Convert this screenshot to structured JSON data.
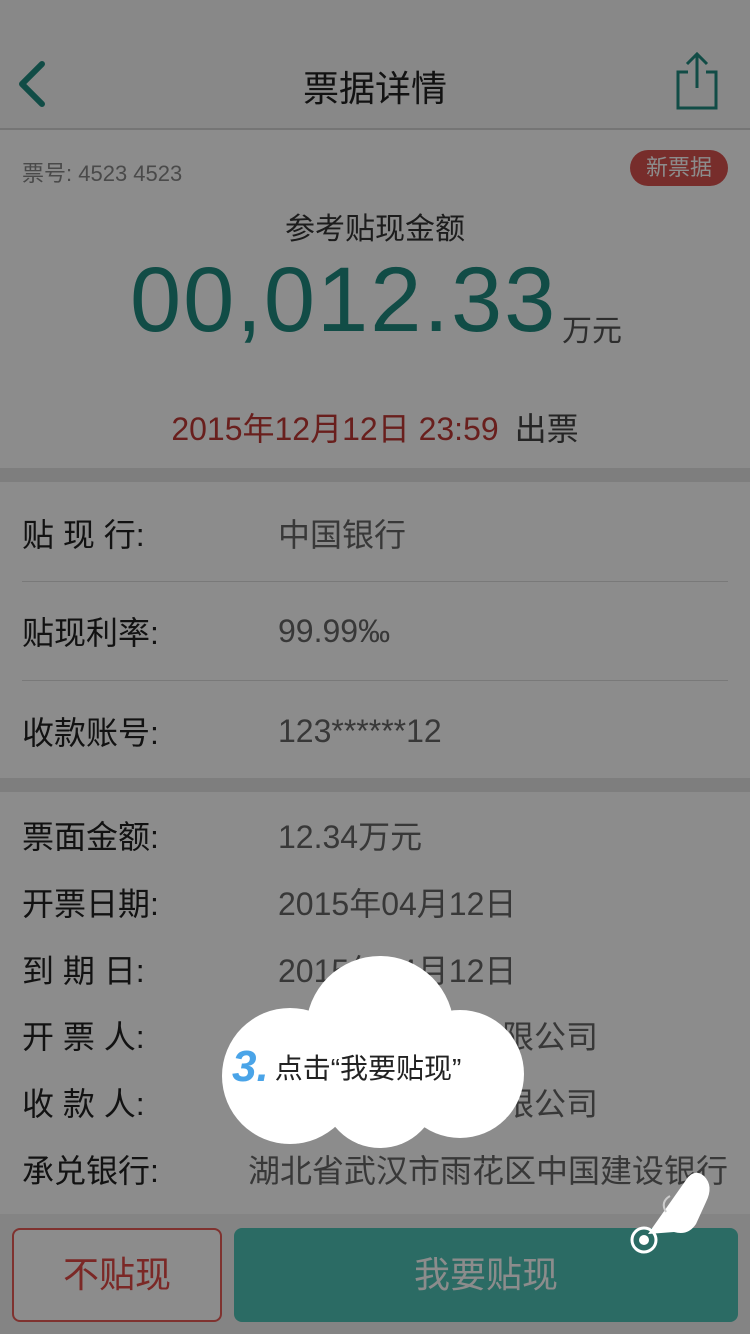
{
  "navbar": {
    "title": "票据详情",
    "back_icon": "chevron-left-icon",
    "share_icon": "share-icon"
  },
  "ticket": {
    "number_label": "票号:",
    "number": "4523 4523",
    "badge": "新票据",
    "amount_label": "参考贴现金额",
    "amount": "00,012.33",
    "amount_unit": "万元",
    "issue_date": "2015年12月12日 23:59",
    "issue_tag": "出票"
  },
  "discount": [
    {
      "label": "贴 现 行:",
      "value": "中国银行"
    },
    {
      "label": "贴现利率:",
      "value": "99.99‰"
    },
    {
      "label": "收款账号:",
      "value": "123******12"
    }
  ],
  "details": [
    {
      "label": "票面金额:",
      "value": "12.34万元"
    },
    {
      "label": "开票日期:",
      "value": "2015年04月12日"
    },
    {
      "label": "到 期 日:",
      "value": "2015年04月12日"
    },
    {
      "label": "开 票 人:",
      "value": "武汉某某技术有限公司"
    },
    {
      "label": "收 款 人:",
      "value": "武汉某某技术有限公司"
    },
    {
      "label": "承兑银行:",
      "value": "湖北省武汉市雨花区中国建设银行"
    }
  ],
  "footer": {
    "decline_label": "不贴现",
    "accept_label": "我要贴现"
  },
  "tip": {
    "step": "3.",
    "text": "点击“我要贴现”"
  },
  "colors": {
    "accent": "#4fc3b6",
    "amount": "#1f8a80",
    "danger": "#d9534f"
  }
}
